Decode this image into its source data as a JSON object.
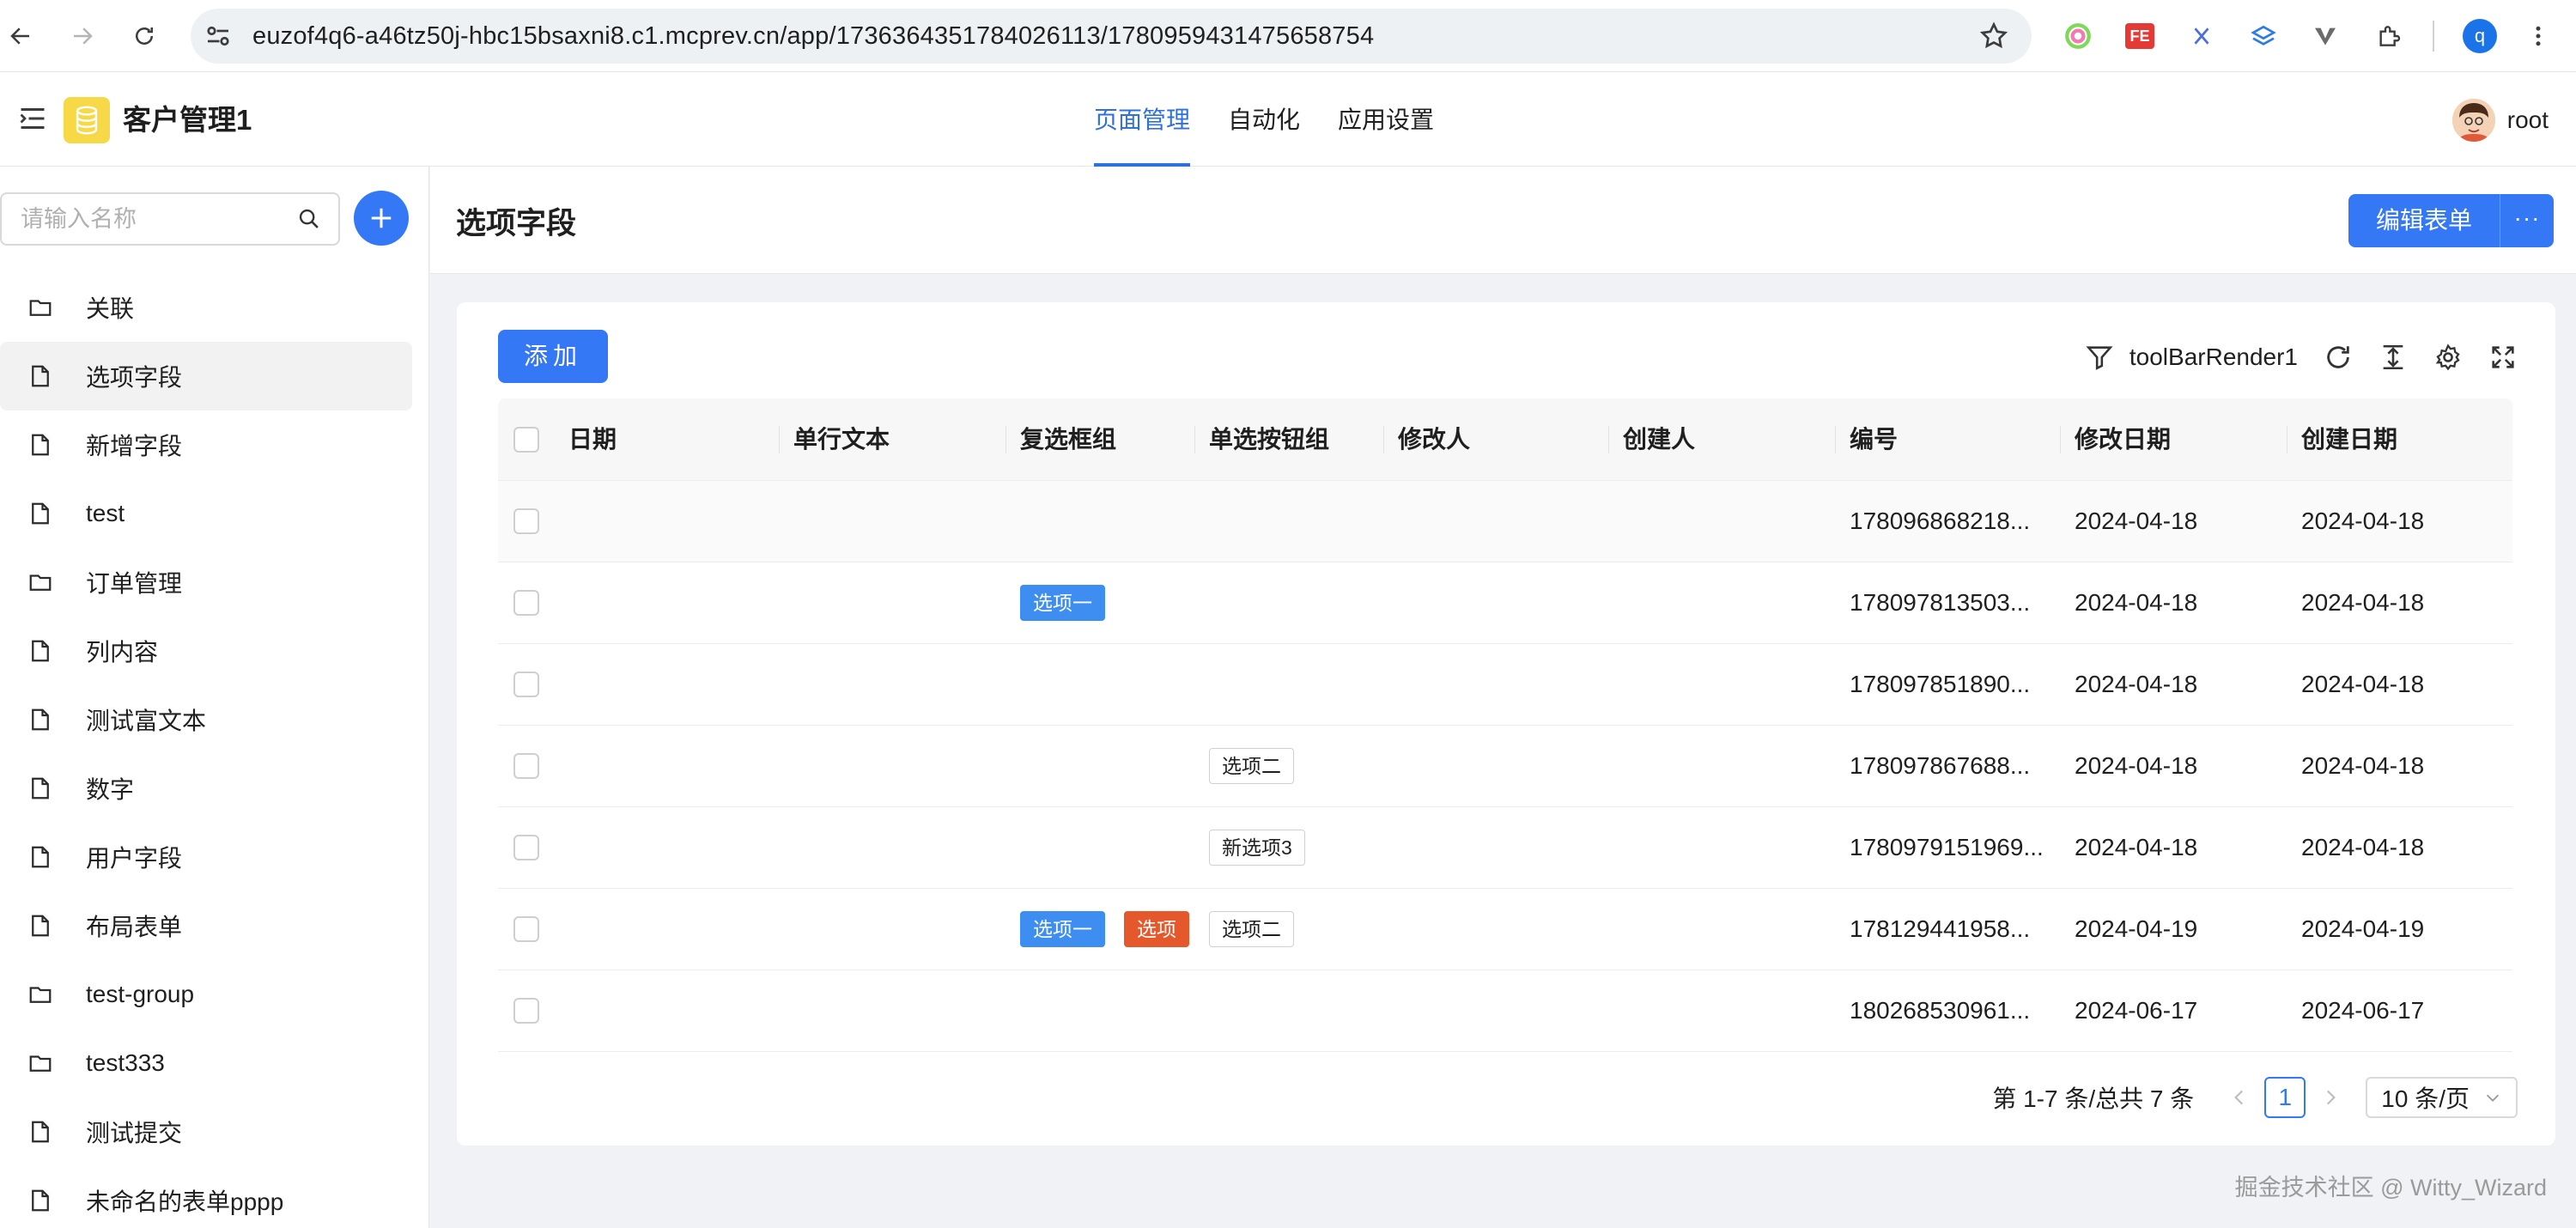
{
  "browser": {
    "url": "euzof4q6-a46tz50j-hbc15bsaxni8.c1.mcprev.cn/app/1736364351784026113/1780959431475658754",
    "profile_initial": "q",
    "ext_fe_label": "FE"
  },
  "app": {
    "title": "客户管理1",
    "tabs": [
      {
        "label": "页面管理",
        "active": true
      },
      {
        "label": "自动化",
        "active": false
      },
      {
        "label": "应用设置",
        "active": false
      }
    ],
    "user": "root"
  },
  "sidebar": {
    "search_placeholder": "请输入名称",
    "items": [
      {
        "label": "关联",
        "icon": "folder-icon"
      },
      {
        "label": "选项字段",
        "icon": "file-icon",
        "active": true
      },
      {
        "label": "新增字段",
        "icon": "file-icon"
      },
      {
        "label": "test",
        "icon": "file-icon"
      },
      {
        "label": "订单管理",
        "icon": "folder-icon"
      },
      {
        "label": "列内容",
        "icon": "file-icon"
      },
      {
        "label": "测试富文本",
        "icon": "file-icon"
      },
      {
        "label": "数字",
        "icon": "file-icon"
      },
      {
        "label": "用户字段",
        "icon": "file-icon"
      },
      {
        "label": "布局表单",
        "icon": "file-icon"
      },
      {
        "label": "test-group",
        "icon": "folder-icon"
      },
      {
        "label": "test333",
        "icon": "folder-icon"
      },
      {
        "label": "测试提交",
        "icon": "file-icon"
      },
      {
        "label": "未命名的表单pppp",
        "icon": "file-icon"
      }
    ]
  },
  "page": {
    "title": "选项字段",
    "edit_label": "编辑表单",
    "more_label": "···"
  },
  "toolbar": {
    "add_label": "添加",
    "render_label": "toolBarRender1"
  },
  "table": {
    "columns": [
      "日期",
      "单行文本",
      "复选框组",
      "单选按钮组",
      "修改人",
      "创建人",
      "编号",
      "修改日期",
      "创建日期"
    ],
    "rows": [
      {
        "date": "",
        "text": "",
        "checkbox_group": [],
        "radio_group": [],
        "modifier": "",
        "creator": "",
        "number": "178096868218...",
        "modified": "2024-04-18",
        "created": "2024-04-18"
      },
      {
        "date": "",
        "text": "",
        "checkbox_group": [
          {
            "label": "选项一",
            "style": "blue"
          }
        ],
        "radio_group": [],
        "modifier": "",
        "creator": "",
        "number": "178097813503...",
        "modified": "2024-04-18",
        "created": "2024-04-18"
      },
      {
        "date": "",
        "text": "",
        "checkbox_group": [],
        "radio_group": [],
        "modifier": "",
        "creator": "",
        "number": "178097851890...",
        "modified": "2024-04-18",
        "created": "2024-04-18"
      },
      {
        "date": "",
        "text": "",
        "checkbox_group": [],
        "radio_group": [
          {
            "label": "选项二",
            "style": "plain"
          }
        ],
        "modifier": "",
        "creator": "",
        "number": "178097867688...",
        "modified": "2024-04-18",
        "created": "2024-04-18"
      },
      {
        "date": "",
        "text": "",
        "checkbox_group": [],
        "radio_group": [
          {
            "label": "新选项3",
            "style": "plain"
          }
        ],
        "modifier": "",
        "creator": "",
        "number": "1780979151969...",
        "modified": "2024-04-18",
        "created": "2024-04-18"
      },
      {
        "date": "",
        "text": "",
        "checkbox_group": [
          {
            "label": "选项一",
            "style": "blue"
          },
          {
            "label": "选项",
            "style": "orange"
          }
        ],
        "radio_group": [
          {
            "label": "选项二",
            "style": "plain"
          }
        ],
        "modifier": "",
        "creator": "",
        "number": "178129441958...",
        "modified": "2024-04-19",
        "created": "2024-04-19"
      },
      {
        "date": "",
        "text": "",
        "checkbox_group": [],
        "radio_group": [],
        "modifier": "",
        "creator": "",
        "number": "180268530961...",
        "modified": "2024-06-17",
        "created": "2024-06-17"
      }
    ]
  },
  "pagination": {
    "summary": "第 1-7 条/总共 7 条",
    "current_page": "1",
    "page_size_label": "10 条/页"
  },
  "watermark": "掘金技术社区 @ Witty_Wizard",
  "colors": {
    "primary": "#3478f6",
    "active_tab": "#2f6fde",
    "tag_blue": "#3d8ef0",
    "tag_orange": "#e5582b",
    "logo_yellow": "#f7d948"
  }
}
